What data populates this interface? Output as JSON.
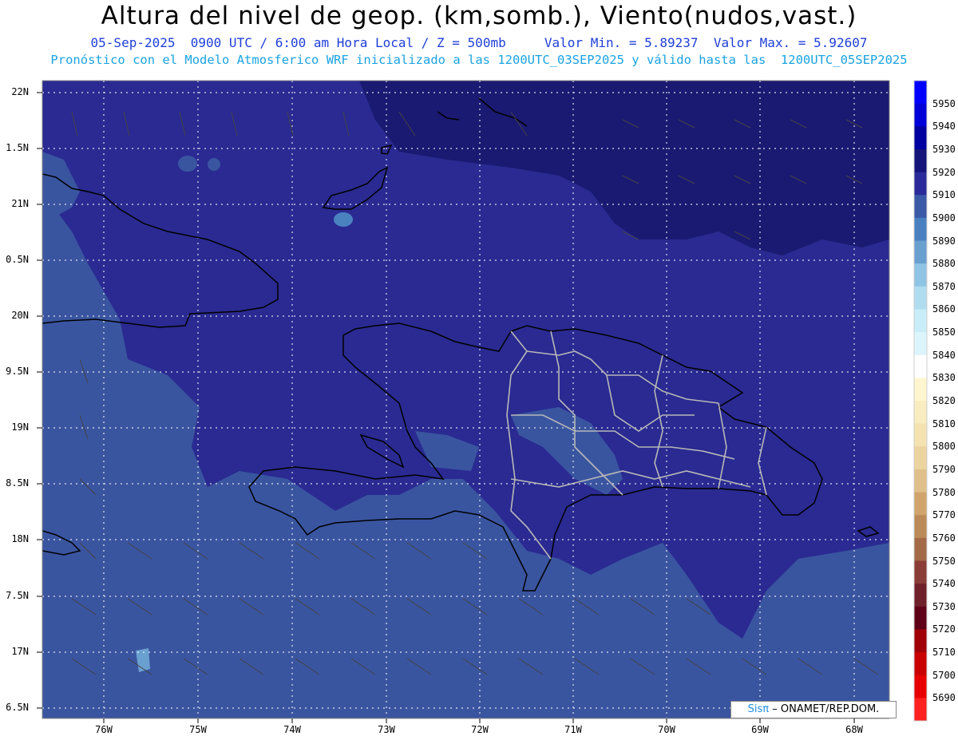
{
  "header": {
    "title": "Altura del nivel de geop. (km,somb.), Viento(nudos,vast.)",
    "date": "05-Sep-2025",
    "time": "0900 UTC / 6:00 am Hora Local / Z = 500mb",
    "min": "Valor Min. = 5.89237",
    "max": "Valor Max. = 5.92607",
    "model": "Pronóstico con el Modelo Atmosferico WRF inicializado a las 1200UTC_03SEP2025 y válido hasta las  1200UTC_05SEP2025"
  },
  "axes": {
    "lat_labels": [
      "22N",
      "1.5N",
      "21N",
      "0.5N",
      "20N",
      "9.5N",
      "19N",
      "8.5N",
      "18N",
      "7.5N",
      "17N",
      "6.5N"
    ],
    "lon_labels": [
      "76W",
      "75W",
      "74W",
      "73W",
      "72W",
      "71W",
      "70W",
      "69W",
      "68W"
    ]
  },
  "colorbar": {
    "labels": [
      "5950",
      "5940",
      "5930",
      "5920",
      "5910",
      "5900",
      "5890",
      "5880",
      "5870",
      "5860",
      "5850",
      "5840",
      "5830",
      "5820",
      "5810",
      "5800",
      "5790",
      "5780",
      "5770",
      "5760",
      "5750",
      "5740",
      "5730",
      "5720",
      "5710",
      "5700",
      "5690"
    ],
    "colors": [
      "#0000ff",
      "#0000d8",
      "#0000a0",
      "#14147a",
      "#2a2a9a",
      "#3a5aa8",
      "#4a80c0",
      "#6aa0d0",
      "#90c4e4",
      "#b0dcf0",
      "#c8ecf8",
      "#dcf4fc",
      "#ffffff",
      "#fff6d0",
      "#f8ecc0",
      "#f4e2b0",
      "#ecd4a0",
      "#e0c08a",
      "#d0a46c",
      "#bc8a56",
      "#a46a48",
      "#8a3c36",
      "#70202a",
      "#600018",
      "#a00008",
      "#c80000",
      "#e80000",
      "#ff2020"
    ]
  },
  "map_colors": {
    "level_5920": "#1a1a72",
    "level_5910": "#2a2a92",
    "level_5900": "#3a55a0",
    "level_5890": "#4a82c0",
    "level_5880": "#6aa0d0"
  },
  "credit": {
    "sis": "Sisπ",
    "text": " ONAMET/REP.DOM."
  }
}
